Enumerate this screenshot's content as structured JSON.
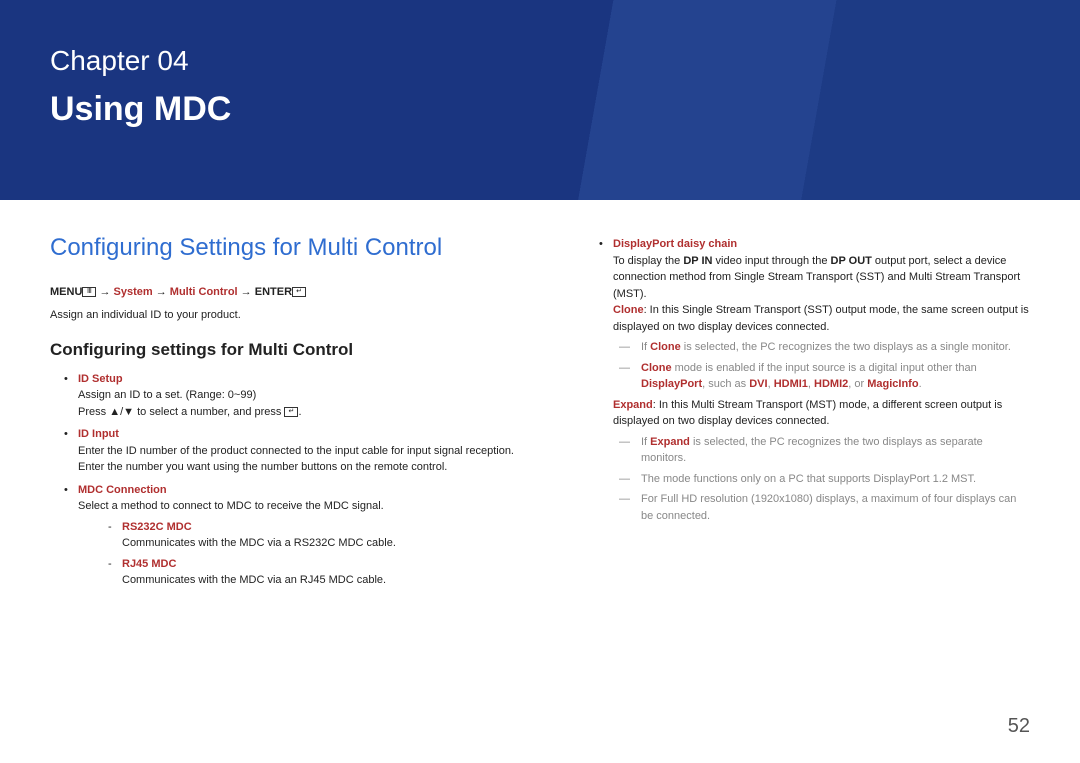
{
  "chapter": {
    "label": "Chapter  04",
    "title": "Using MDC"
  },
  "section": {
    "heading": "Configuring Settings for Multi Control",
    "nav_prefix": "MENU",
    "nav_icon": "Ⅲ",
    "nav_arrow1": " → ",
    "nav_system": "System",
    "nav_arrow2": " → ",
    "nav_multi": "Multi Control",
    "nav_arrow3": " → ",
    "nav_enter": "ENTER",
    "nav_enter_icon": "↵",
    "intro": "Assign an individual ID to your product.",
    "subheading": "Configuring settings for Multi Control"
  },
  "left_list": {
    "id_setup": {
      "label": "ID Setup",
      "line1": "Assign an ID to a set. (Range: 0~99)",
      "line2_pre": "Press ",
      "line2_arrows": "▲/▼",
      "line2_mid": " to select a number, and press ",
      "line2_icon": "↵",
      "line2_post": "."
    },
    "id_input": {
      "label": "ID Input",
      "line1": "Enter the ID number of the product connected to the input cable for input signal reception.",
      "line2": "Enter the number you want using the number buttons on the remote control."
    },
    "mdc_conn": {
      "label": "MDC Connection",
      "line1": "Select a method to connect to MDC to receive the MDC signal.",
      "rs232c": {
        "label": "RS232C MDC",
        "desc": "Communicates with the MDC via a RS232C MDC cable."
      },
      "rj45": {
        "label": "RJ45 MDC",
        "desc": "Communicates with the MDC via an RJ45 MDC cable."
      }
    }
  },
  "right_list": {
    "dp_chain": {
      "label": "DisplayPort daisy chain",
      "line1_a": "To display the ",
      "line1_b": "DP IN",
      "line1_c": " video input through the ",
      "line1_d": "DP OUT",
      "line1_e": " output port, select a device connection method from Single Stream Transport (SST) and Multi Stream Transport (MST).",
      "clone_label": "Clone",
      "clone_desc": ": In this Single Stream Transport (SST) output mode, the same screen output is displayed on two display devices connected.",
      "note1_a": "If ",
      "note1_b": "Clone",
      "note1_c": " is selected, the PC recognizes the two displays as a single monitor.",
      "note2_a": "Clone",
      "note2_b": " mode is enabled if the input source is a digital input other than ",
      "note2_c": "DisplayPort",
      "note2_d": ", such as ",
      "note2_e": "DVI",
      "note2_f": ", ",
      "note2_g": "HDMI1",
      "note2_h": ", ",
      "note2_i": "HDMI2",
      "note2_j": ", or ",
      "note2_k": "MagicInfo",
      "note2_l": ".",
      "expand_label": "Expand",
      "expand_desc": ": In this Multi Stream Transport (MST) mode, a different screen output is displayed on two display devices connected.",
      "note3_a": "If ",
      "note3_b": "Expand",
      "note3_c": " is selected, the PC recognizes the two displays as separate monitors.",
      "note4": "The mode functions only on a PC that supports DisplayPort 1.2 MST.",
      "note5": "For Full HD resolution (1920x1080) displays, a maximum of four displays can be connected."
    }
  },
  "page_number": "52"
}
